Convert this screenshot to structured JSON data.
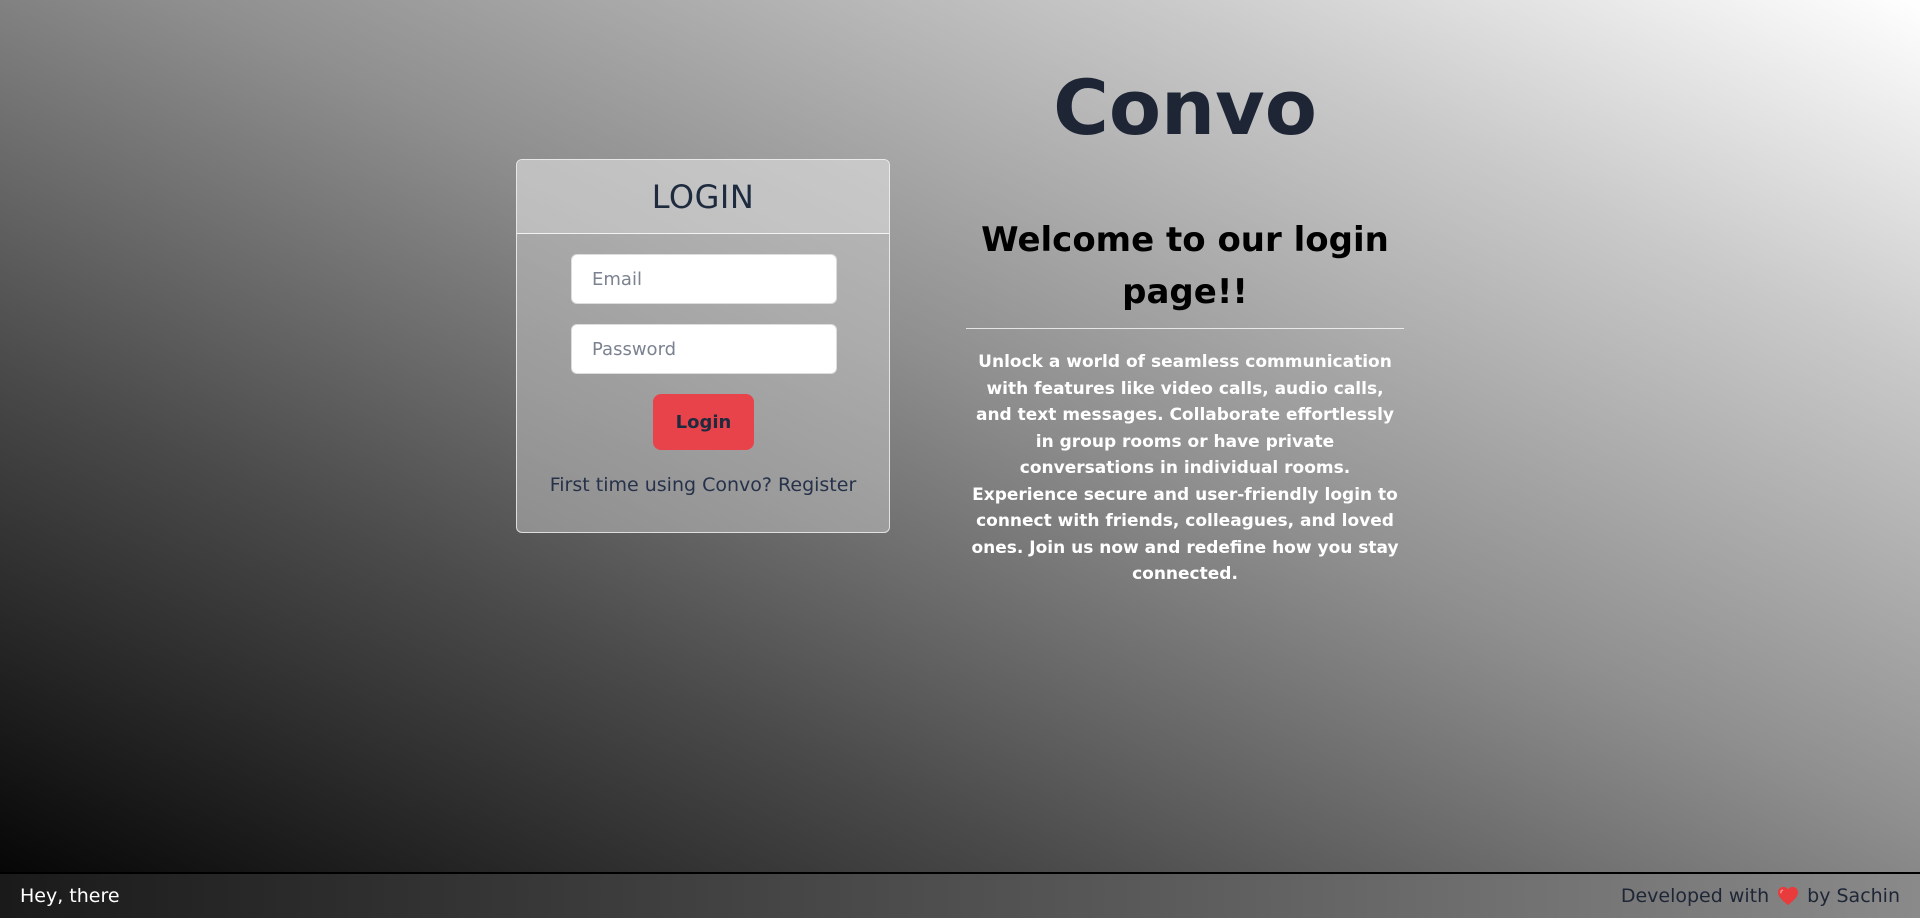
{
  "login_card": {
    "title": "LOGIN",
    "email_placeholder": "Email",
    "password_placeholder": "Password",
    "login_button": "Login",
    "register_prompt": "First time using Convo?",
    "register_link": "Register"
  },
  "hero": {
    "brand": "Convo",
    "welcome_title": "Welcome to our login page!!",
    "description": "Unlock a world of seamless communication with features like video calls, audio calls, and text messages. Collaborate effortlessly in group rooms or have private conversations in individual rooms. Experience secure and user-friendly login to connect with friends, colleagues, and loved ones. Join us now and redefine how you stay connected."
  },
  "footer": {
    "greeting": "Hey, there",
    "developed_prefix": "Developed with",
    "developed_suffix": "by Sachin",
    "heart_icon": "heart-icon"
  },
  "colors": {
    "login_button": "#e8434a",
    "heading_text": "#1e2b3f",
    "heart": "#e83b3b"
  }
}
